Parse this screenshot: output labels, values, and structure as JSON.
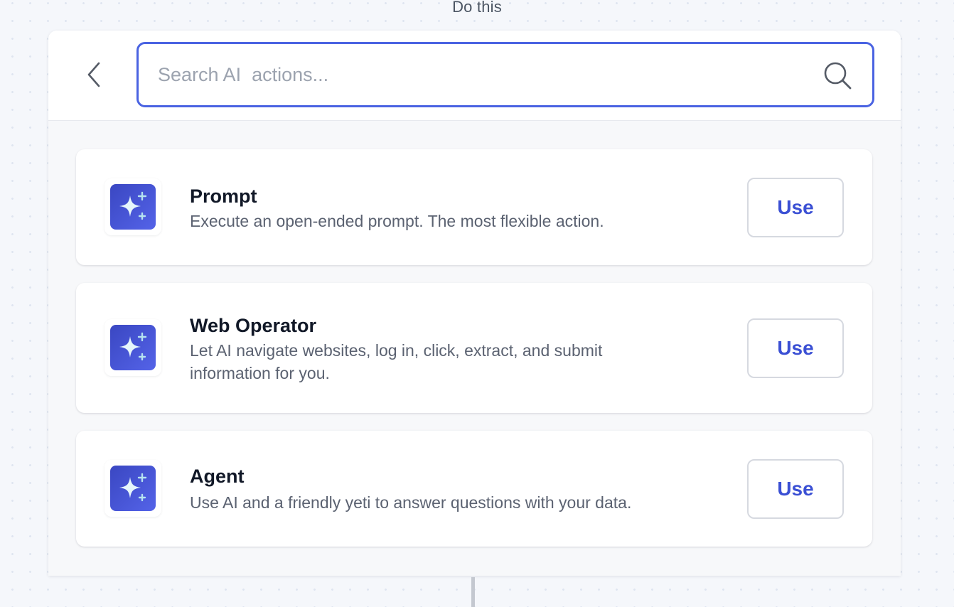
{
  "step_label": "Do this",
  "search": {
    "value": "",
    "placeholder": "Search AI  actions..."
  },
  "actions": [
    {
      "title": "Prompt",
      "description": "Execute an open-ended prompt. The most flexible action.",
      "button_label": "Use",
      "icon": "sparkles-icon"
    },
    {
      "title": "Web Operator",
      "description": "Let AI navigate websites, log in, click, extract, and submit information for you.",
      "button_label": "Use",
      "icon": "sparkles-icon"
    },
    {
      "title": "Agent",
      "description": "Use AI and a friendly yeti to answer questions with your data.",
      "button_label": "Use",
      "icon": "sparkles-icon"
    }
  ],
  "colors": {
    "accent": "#4a63e2",
    "button_text": "#3b50d4",
    "icon_gradient_start": "#3a47c2",
    "icon_gradient_end": "#5463e8",
    "sparkle": "#e6f6fb",
    "background": "#f5f7fb"
  }
}
